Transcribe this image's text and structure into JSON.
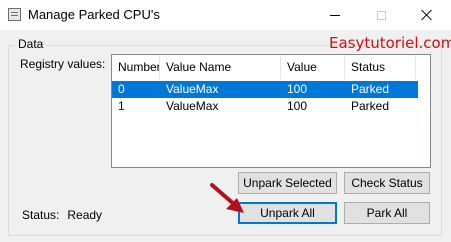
{
  "window": {
    "title": "Manage Parked CPU's"
  },
  "watermark": "Easytutoriel.com",
  "group": {
    "label": "Data",
    "registry_label": "Registry values:"
  },
  "listview": {
    "columns": [
      "Number",
      "Value Name",
      "Value",
      "Status"
    ],
    "rows": [
      [
        "0",
        "ValueMax",
        "100",
        "Parked"
      ],
      [
        "1",
        "ValueMax",
        "100",
        "Parked"
      ]
    ],
    "selected_row": 0,
    "selection_color": "#0078d7"
  },
  "buttons": {
    "unpark_selected": "Unpark Selected",
    "check_status": "Check Status",
    "unpark_all": "Unpark All",
    "park_all": "Park All"
  },
  "status": {
    "label": "Status:",
    "value": "Ready"
  },
  "colors": {
    "accent": "#0078d7",
    "annotation_arrow": "#b01020",
    "watermark": "#d01010"
  }
}
